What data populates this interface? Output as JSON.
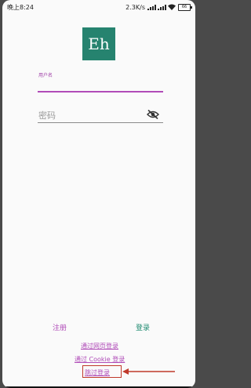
{
  "status_bar": {
    "time": "晚上8:24",
    "network_speed": "2.3K/s",
    "battery": "66"
  },
  "app": {
    "logo_text": "Eh"
  },
  "form": {
    "username_label": "用户名",
    "username_value": "",
    "password_placeholder": "密码"
  },
  "actions": {
    "register_label": "注册",
    "login_label": "登录",
    "web_login_label": "通过网页登录",
    "cookie_login_label": "通过 Cookie 登录",
    "skip_login_label": "跳过登录"
  },
  "colors": {
    "logo_bg": "#26836f",
    "accent": "#b04cb8",
    "primary": "#1e8a70",
    "annotation": "#c0392b"
  },
  "icons": [
    "visibility-off-icon",
    "signal-icon",
    "wifi-icon",
    "battery-icon"
  ]
}
